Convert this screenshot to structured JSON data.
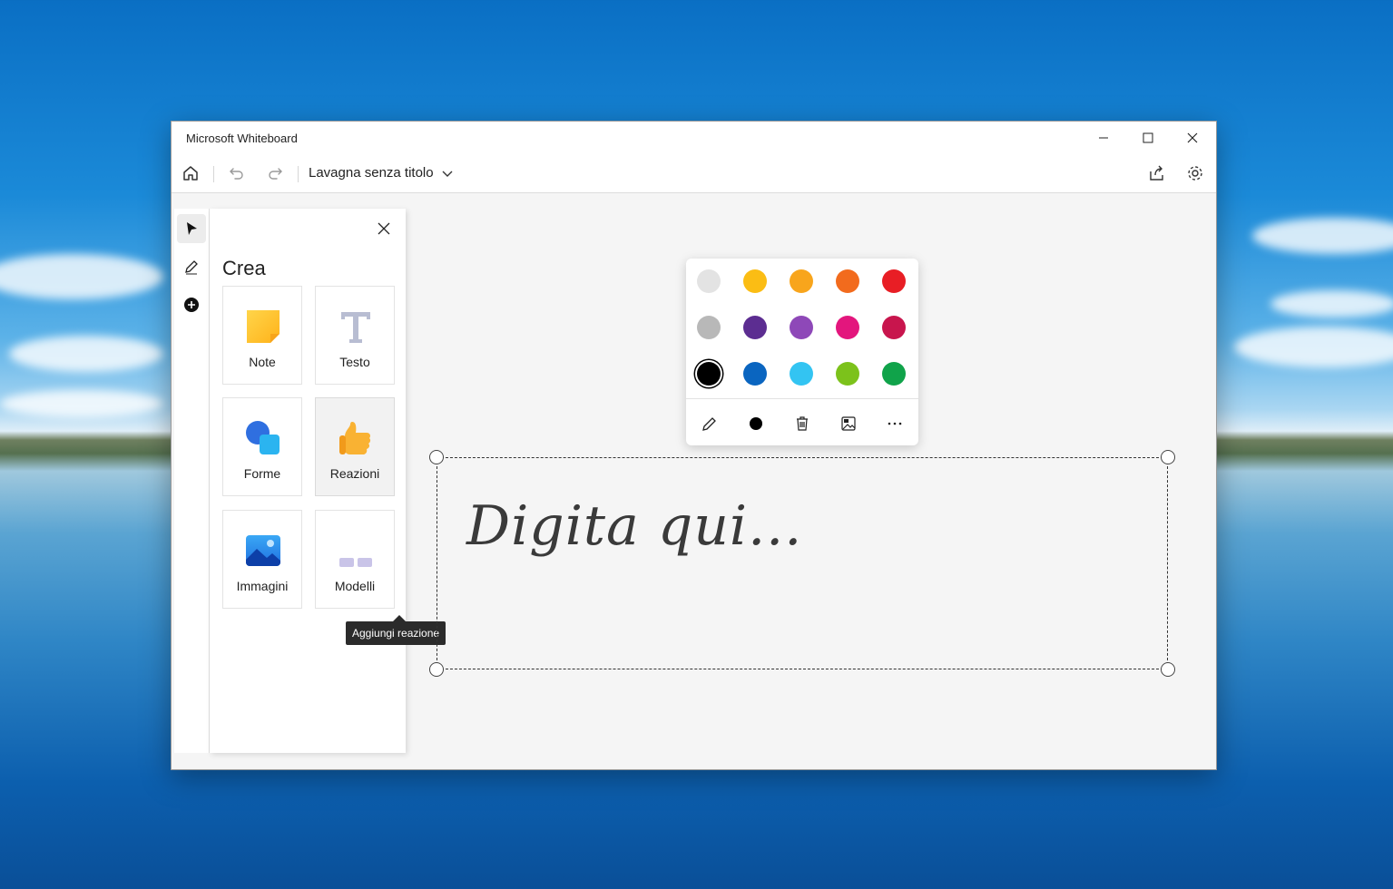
{
  "app": {
    "title": "Microsoft Whiteboard",
    "board_name": "Lavagna senza titolo"
  },
  "window_controls": [
    "minimize-icon",
    "maximize-icon",
    "close-icon"
  ],
  "toolbar": {
    "left_icons": [
      "home-icon",
      "undo-icon",
      "redo-icon"
    ],
    "right_icons": [
      "share-icon",
      "gear-icon"
    ]
  },
  "rail": {
    "icons": [
      "pointer-icon",
      "pen-icon",
      "add-icon"
    ]
  },
  "create_panel": {
    "title": "Crea",
    "items": [
      {
        "label": "Note",
        "icon": "sticky-note-icon"
      },
      {
        "label": "Testo",
        "icon": "text-icon"
      },
      {
        "label": "Forme",
        "icon": "shapes-icon"
      },
      {
        "label": "Reazioni",
        "icon": "thumbs-up-icon"
      },
      {
        "label": "Immagini",
        "icon": "image-icon"
      },
      {
        "label": "Modelli",
        "icon": "templates-icon"
      }
    ],
    "tooltip": "Aggiungi reazione"
  },
  "palette": {
    "colors": [
      "#e3e3e3",
      "#fbbd14",
      "#f8a51c",
      "#f26b1d",
      "#e81e25",
      "#b8b8b8",
      "#5c2d91",
      "#8e48b8",
      "#e3167d",
      "#c8154d",
      "#000000",
      "#0a65c0",
      "#33c4f2",
      "#7cc21b",
      "#10a34a"
    ],
    "selected_color": "#000000",
    "tools": [
      "pen-icon",
      "stroke-dot-icon",
      "trash-icon",
      "replace-image-icon",
      "more-icon"
    ]
  },
  "canvas": {
    "placeholder": "Digita qui..."
  }
}
